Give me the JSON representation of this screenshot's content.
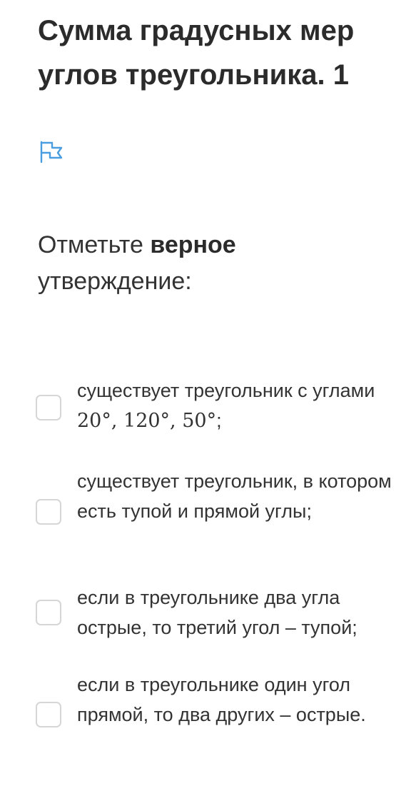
{
  "title": "Сумма градусных мер углов треугольника. 1",
  "flag_icon": "flag-icon",
  "accent_color": "#4a9ee0",
  "question": {
    "prefix": "Отметьте ",
    "bold": "верное",
    "suffix": " утверждение:"
  },
  "options": [
    {
      "text_before": "существует треугольник с углами ",
      "math": "20°, 120°, 50°",
      "text_after": ";"
    },
    {
      "text": "существует треугольник, в котором есть тупой и прямой углы;"
    },
    {
      "text": "если в треугольнике два угла острые, то третий угол – тупой;"
    },
    {
      "text": "если в треугольнике один угол прямой, то два других – острые."
    }
  ]
}
